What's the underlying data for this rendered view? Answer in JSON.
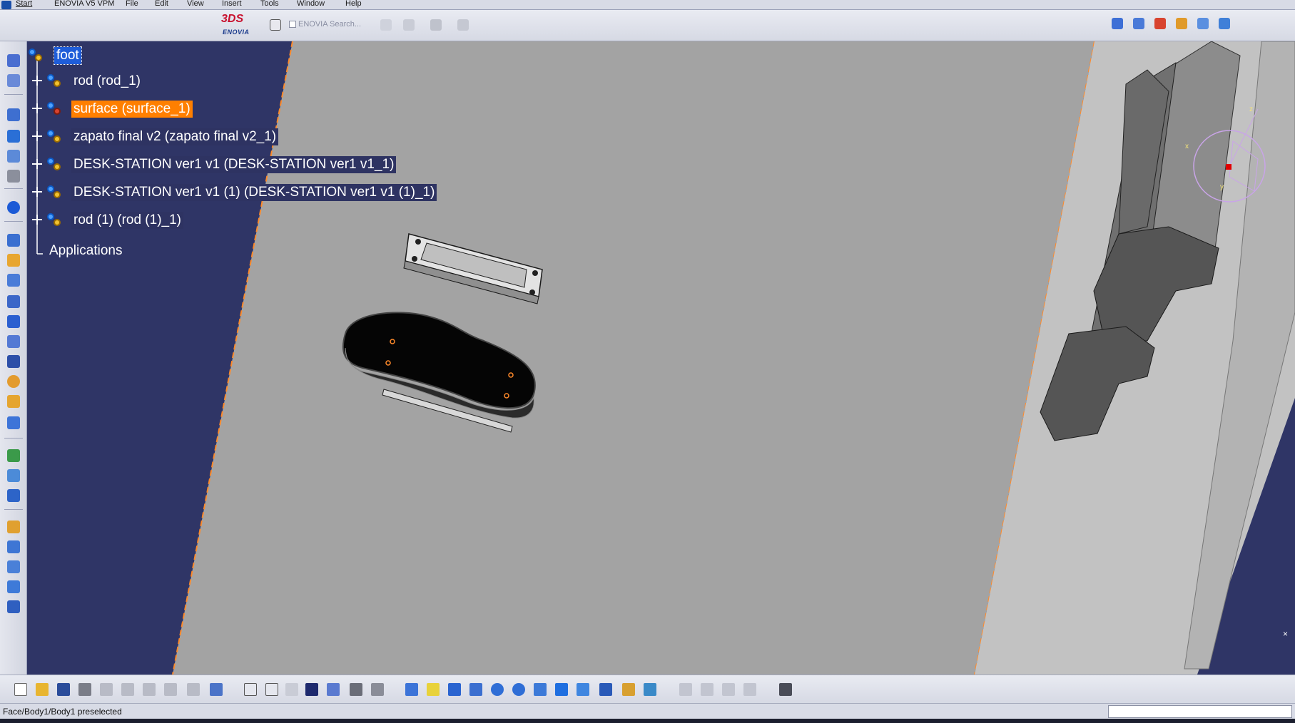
{
  "menubar": {
    "items": [
      "Start",
      "ENOVIA V5 VPM",
      "File",
      "Edit",
      "View",
      "Insert",
      "Tools",
      "Window",
      "Help"
    ]
  },
  "toolbar_top": {
    "enovia_search_label": "ENOVIA Search..."
  },
  "tree": {
    "root": "foot",
    "nodes": [
      {
        "label": "rod (rod_1)",
        "state": "normal"
      },
      {
        "label": "surface (surface_1)",
        "state": "highlighted"
      },
      {
        "label": "zapato final v2 (zapato final v2_1)",
        "state": "dark"
      },
      {
        "label": "DESK-STATION ver1 v1 (DESK-STATION ver1 v1_1)",
        "state": "dark"
      },
      {
        "label": "DESK-STATION ver1 v1 (1) (DESK-STATION ver1 v1 (1)_1)",
        "state": "dark"
      },
      {
        "label": "rod (1) (rod (1)_1)",
        "state": "dark"
      }
    ],
    "applications": "Applications"
  },
  "compass": {
    "axis_x": "x",
    "axis_y": "y",
    "axis_z": "z"
  },
  "status": {
    "text": "Face/Body1/Body1 preselected"
  },
  "colors": {
    "background": "#2f3566",
    "plane": "#a3a3a3",
    "plane_edge": "#ff8a2a",
    "tree_selected": "#1f5dd9",
    "tree_highlight": "#ff7f00"
  }
}
